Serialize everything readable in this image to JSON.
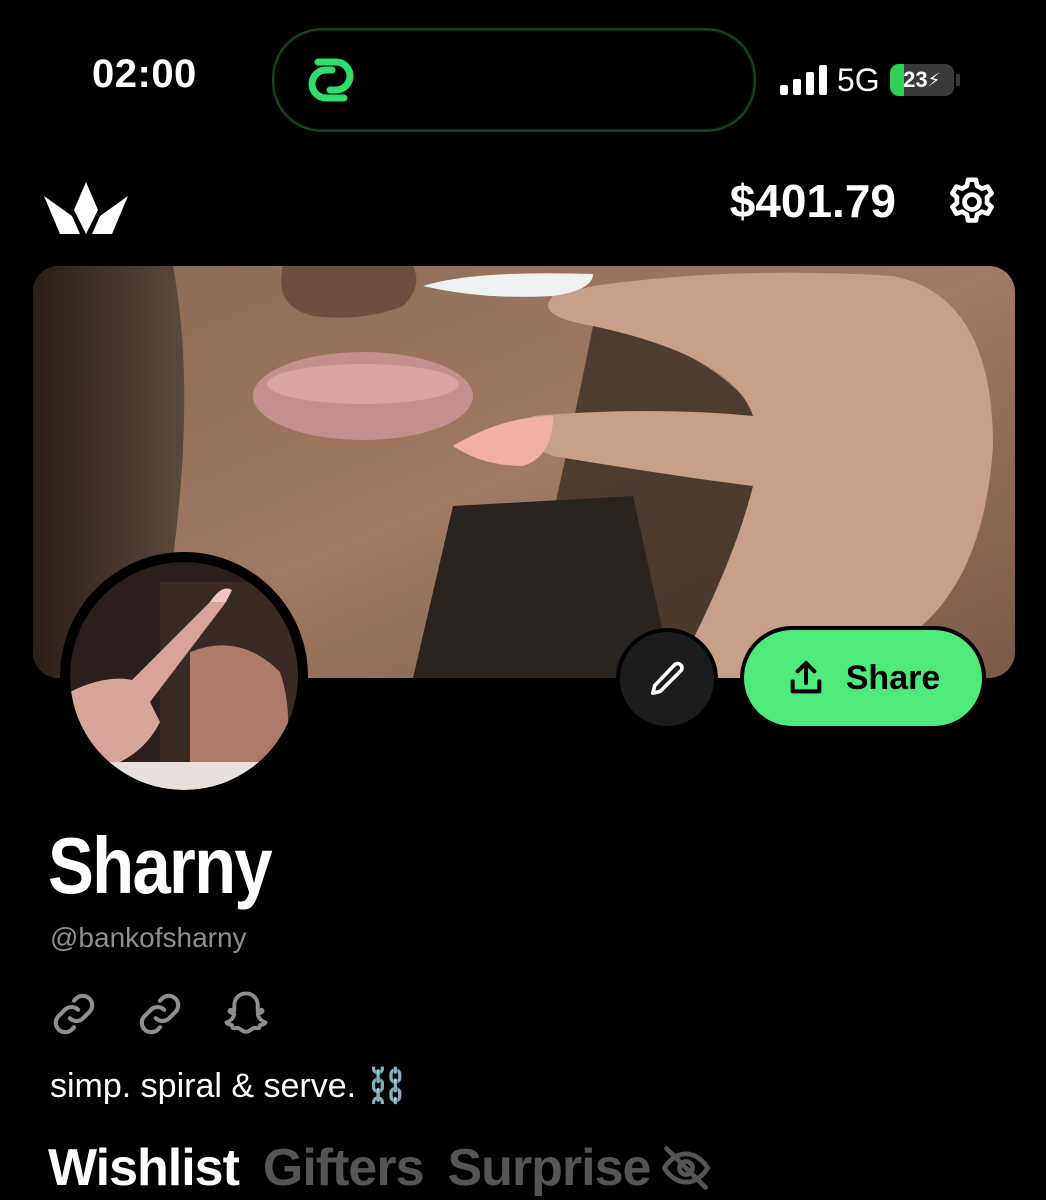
{
  "status_bar": {
    "time": "02:00",
    "network": "5G",
    "battery": "23",
    "battery_level": 0.23
  },
  "header": {
    "balance": "$401.79"
  },
  "banner": {
    "edit_icon": "pencil-icon",
    "share_label": "Share",
    "share_icon": "share-upload-icon"
  },
  "profile": {
    "name": "Sharny",
    "handle": "@bankofsharny",
    "links": [
      "link-icon",
      "link-icon",
      "snapchat-icon"
    ],
    "bio": "simp. spiral & serve. ⛓️"
  },
  "tabs": [
    {
      "label": "Wishlist",
      "active": true
    },
    {
      "label": "Gifters",
      "active": false
    },
    {
      "label": "Surprise",
      "active": false
    }
  ],
  "colors": {
    "accent": "#4eea7b",
    "background": "#000000",
    "muted": "#8e8e93"
  }
}
